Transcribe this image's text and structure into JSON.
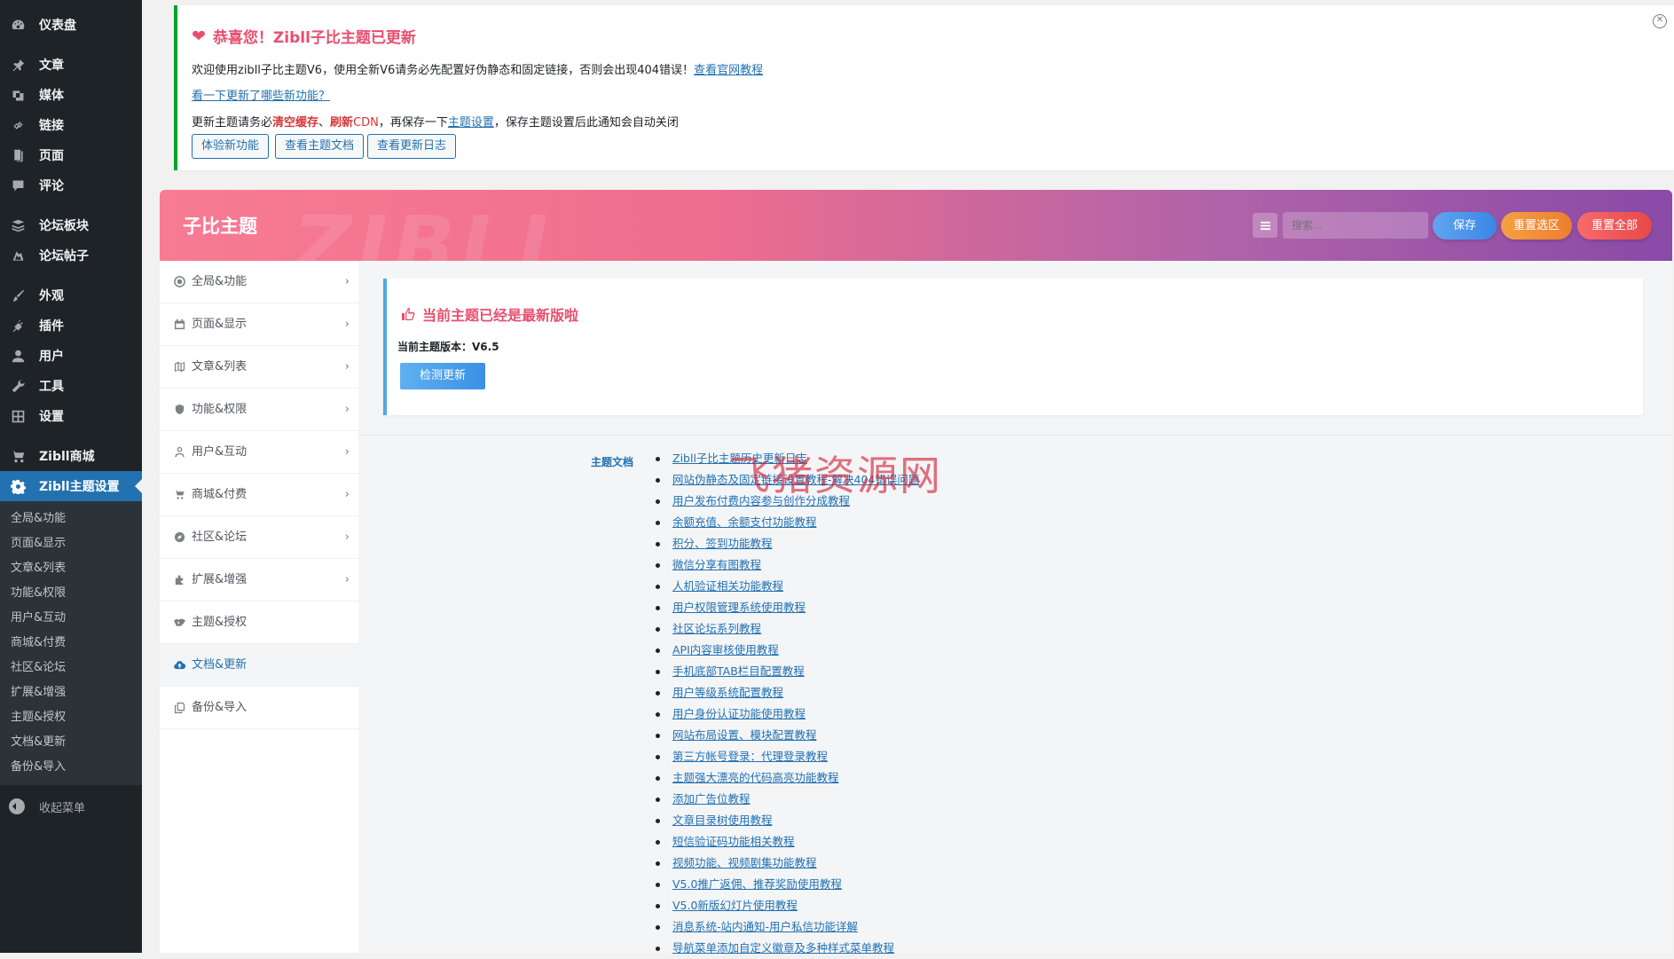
{
  "sidebar": {
    "items": [
      {
        "label": "仪表盘",
        "icon": "dashboard-icon"
      },
      {
        "label": "文章",
        "icon": "pin-icon"
      },
      {
        "label": "媒体",
        "icon": "media-icon"
      },
      {
        "label": "链接",
        "icon": "link-icon"
      },
      {
        "label": "页面",
        "icon": "page-icon"
      },
      {
        "label": "评论",
        "icon": "comment-icon"
      },
      {
        "label": "论坛板块",
        "icon": "forum-board-icon"
      },
      {
        "label": "论坛帖子",
        "icon": "forum-post-icon"
      },
      {
        "label": "外观",
        "icon": "brush-icon"
      },
      {
        "label": "插件",
        "icon": "plugin-icon"
      },
      {
        "label": "用户",
        "icon": "user-icon"
      },
      {
        "label": "工具",
        "icon": "wrench-icon"
      },
      {
        "label": "设置",
        "icon": "settings-icon"
      },
      {
        "label": "Zibll商城",
        "icon": "cart-icon"
      },
      {
        "label": "Zibll主题设置",
        "icon": "gear-icon"
      }
    ],
    "submenu": [
      "全局&功能",
      "页面&显示",
      "文章&列表",
      "功能&权限",
      "用户&互动",
      "商城&付费",
      "社区&论坛",
      "扩展&增强",
      "主题&授权",
      "文档&更新",
      "备份&导入"
    ],
    "collapse_label": "收起菜单"
  },
  "notice": {
    "title": "恭喜您！Zibll子比主题已更新",
    "line1_text": "欢迎使用zibll子比主题V6，使用全新V6请务必先配置好伪静态和固定链接，否则会出现404错误！",
    "line1_link": "查看官网教程",
    "line2_link": "看一下更新了哪些新功能？",
    "line3_a": "更新主题请务必",
    "line3_b": "清空缓存",
    "line3_c": "、",
    "line3_d": "刷新",
    "line3_e": "CDN",
    "line3_f": "，再保存一下",
    "line3_link": "主题设置",
    "line3_g": "，保存主题设置后此通知会自动关闭",
    "buttons": [
      "体验新功能",
      "查看主题文档",
      "查看更新日志"
    ],
    "close_glyph": "✕"
  },
  "header": {
    "title": "子比主题",
    "watermark": "ZIBLL",
    "search_placeholder": "搜索...",
    "save_label": "保存",
    "reset_section_label": "重置选区",
    "reset_all_label": "重置全部"
  },
  "nav": {
    "items": [
      {
        "label": "全局&功能",
        "icon": "circle-dot-icon",
        "chevron": "›"
      },
      {
        "label": "页面&显示",
        "icon": "calendar-icon",
        "chevron": "›"
      },
      {
        "label": "文章&列表",
        "icon": "map-icon",
        "chevron": "›"
      },
      {
        "label": "功能&权限",
        "icon": "shield-icon",
        "chevron": "›"
      },
      {
        "label": "用户&互动",
        "icon": "user-outline-icon",
        "chevron": "›"
      },
      {
        "label": "商城&付费",
        "icon": "cart-icon",
        "chevron": "›"
      },
      {
        "label": "社区&论坛",
        "icon": "compass-icon",
        "chevron": "›"
      },
      {
        "label": "扩展&增强",
        "icon": "puzzle-icon",
        "chevron": "›"
      },
      {
        "label": "主题&授权",
        "icon": "handshake-icon",
        "chevron": ""
      },
      {
        "label": "文档&更新",
        "icon": "cloud-upload-icon",
        "chevron": ""
      },
      {
        "label": "备份&导入",
        "icon": "copy-icon",
        "chevron": ""
      }
    ]
  },
  "version": {
    "title": "当前主题已经是最新版啦",
    "current_label": "当前主题版本：V6.5",
    "check_button": "检测更新"
  },
  "docs": {
    "label": "主题文档",
    "links": [
      "Zibll子比主题历史更新日志",
      "网站伪静态及固定链接设置教程-解决404错误问题",
      "用户发布付费内容参与创作分成教程",
      "余额充值、余额支付功能教程",
      "积分、签到功能教程",
      "微信分享有图教程",
      "人机验证相关功能教程",
      "用户权限管理系统使用教程",
      "社区论坛系列教程",
      "API内容审核使用教程",
      "手机底部TAB栏目配置教程",
      "用户等级系统配置教程",
      "用户身份认证功能使用教程",
      "网站布局设置、模块配置教程",
      "第三方帐号登录：代理登录教程",
      "主题强大漂亮的代码高亮功能教程",
      "添加广告位教程",
      "文章目录树使用教程",
      "短信验证码功能相关教程",
      "视频功能、视频剧集功能教程",
      "V5.0推广返佣、推荐奖励使用教程",
      "V5.0新版幻灯片使用教程",
      "消息系统-站内通知-用户私信功能详解",
      "导航菜单添加自定义徽章及多种样式菜单教程"
    ]
  },
  "watermark_overlay": "飞猪资源网",
  "colors": {
    "admin_bg": "#1d2327",
    "admin_current": "#2271b1",
    "notice_border": "#00a32a",
    "accent_pink": "#e84f6f",
    "link_blue": "#2271b1"
  }
}
